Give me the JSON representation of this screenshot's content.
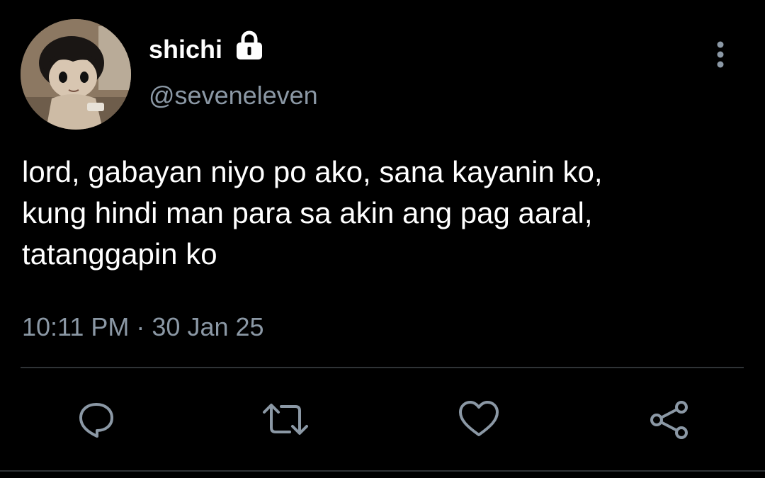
{
  "tweet": {
    "author": {
      "display_name": "shichi",
      "handle": "@seveneleven",
      "protected_icon": "lock-icon",
      "avatar": "avatar"
    },
    "text_lines": [
      "lord, gabayan niyo po ako, sana kayanin ko,",
      "kung hindi man para sa akin ang pag aaral,",
      "tatanggapin ko"
    ],
    "timestamp": "10:11 PM · 30 Jan 25"
  },
  "menu_icon": "more-vertical-icon",
  "actions": [
    {
      "name": "reply",
      "icon": "reply-icon"
    },
    {
      "name": "retweet",
      "icon": "retweet-icon"
    },
    {
      "name": "like",
      "icon": "heart-icon"
    },
    {
      "name": "share",
      "icon": "share-icon"
    }
  ],
  "colors": {
    "background": "#000000",
    "primary_text": "#ffffff",
    "secondary_text": "#8b98a5",
    "divider": "#2f3336"
  }
}
